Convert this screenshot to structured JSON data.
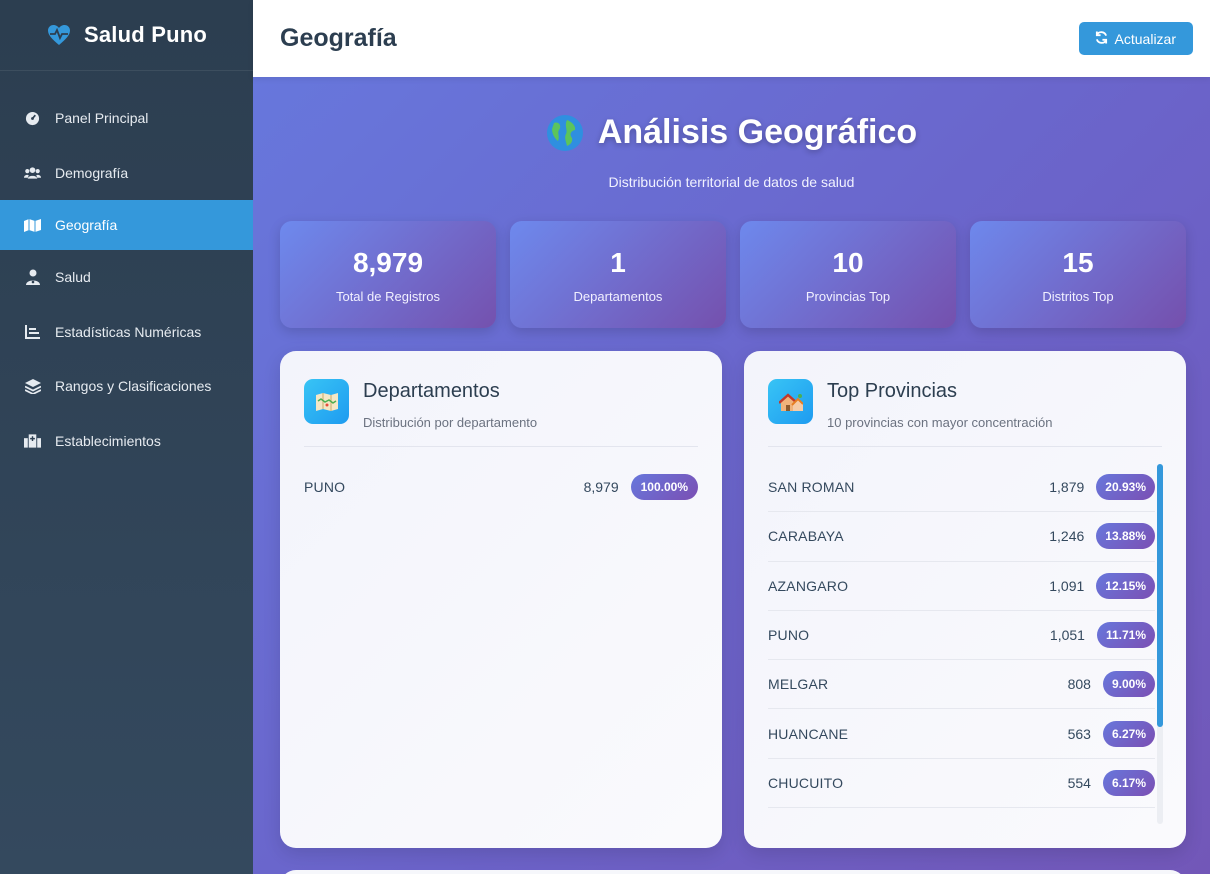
{
  "brand": {
    "name": "Salud Puno",
    "icon": "heartbeat-icon",
    "color": "#3498db"
  },
  "sidebar": {
    "items": [
      {
        "label": "Panel Principal",
        "icon": "tachometer-icon",
        "active": false
      },
      {
        "label": "Demografía",
        "icon": "users-icon",
        "active": false
      },
      {
        "label": "Geografía",
        "icon": "map-icon",
        "active": true
      },
      {
        "label": "Salud",
        "icon": "user-doctor-icon",
        "active": false
      },
      {
        "label": "Estadísticas Numéricas",
        "icon": "chart-bar-icon",
        "active": false
      },
      {
        "label": "Rangos y Clasificaciones",
        "icon": "layers-icon",
        "active": false
      },
      {
        "label": "Establecimientos",
        "icon": "hospital-icon",
        "active": false
      }
    ]
  },
  "header": {
    "title": "Geografía",
    "refresh_label": "Actualizar"
  },
  "hero": {
    "title": "Análisis Geográfico",
    "subtitle": "Distribución territorial de datos de salud"
  },
  "stats": [
    {
      "value": "8,979",
      "label": "Total de Registros"
    },
    {
      "value": "1",
      "label": "Departamentos"
    },
    {
      "value": "10",
      "label": "Provincias Top"
    },
    {
      "value": "15",
      "label": "Distritos Top"
    }
  ],
  "departamentos": {
    "title": "Departamentos",
    "subtitle": "Distribución por departamento",
    "icon": "map-folded-icon",
    "rows": [
      {
        "name": "PUNO",
        "count": "8,979",
        "pct": "100.00%"
      }
    ]
  },
  "provincias": {
    "title": "Top Provincias",
    "subtitle": "10 provincias con mayor concentración",
    "icon": "houses-icon",
    "rows": [
      {
        "name": "SAN ROMAN",
        "count": "1,879",
        "pct": "20.93%"
      },
      {
        "name": "CARABAYA",
        "count": "1,246",
        "pct": "13.88%"
      },
      {
        "name": "AZANGARO",
        "count": "1,091",
        "pct": "12.15%"
      },
      {
        "name": "PUNO",
        "count": "1,051",
        "pct": "11.71%"
      },
      {
        "name": "MELGAR",
        "count": "808",
        "pct": "9.00%"
      },
      {
        "name": "HUANCANE",
        "count": "563",
        "pct": "6.27%"
      },
      {
        "name": "CHUCUITO",
        "count": "554",
        "pct": "6.17%"
      }
    ]
  },
  "colors": {
    "accent": "#3498db",
    "sidebar": "#2c3e50",
    "pill_start": "#6777dc",
    "pill_end": "#7b4fb3"
  }
}
